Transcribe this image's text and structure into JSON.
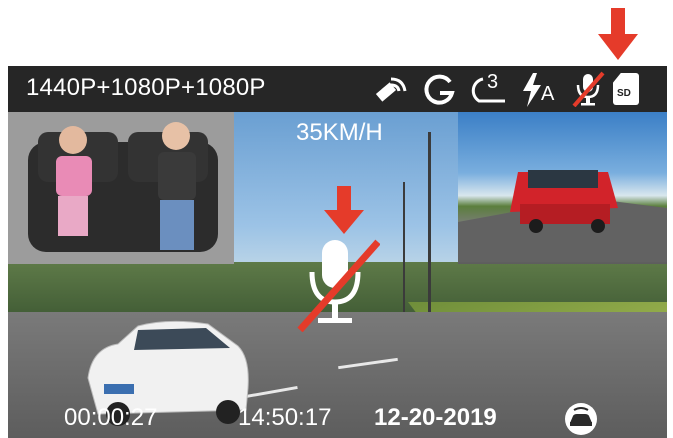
{
  "topbar": {
    "resolution": "1440P+1080P+1080P",
    "icons": [
      "gps-signal-icon",
      "g-sensor-icon",
      "loop-recording-3min-icon",
      "flash-auto-icon",
      "microphone-muted-icon",
      "sd-card-icon"
    ],
    "loop_minutes": "3",
    "flash_mode_label": "A",
    "sd_label": "SD"
  },
  "main": {
    "speed": "35KM/H",
    "center_icon": "microphone-muted-icon"
  },
  "bottombar": {
    "recording_time": "00:00:27",
    "clock": "14:50:17",
    "date": "12-20-2019",
    "status_icon": "parking-monitor-icon"
  },
  "annotations": {
    "arrow_color": "#e53b2a",
    "arrows": [
      "arrow-to-status-mic",
      "arrow-to-center-mic"
    ]
  }
}
